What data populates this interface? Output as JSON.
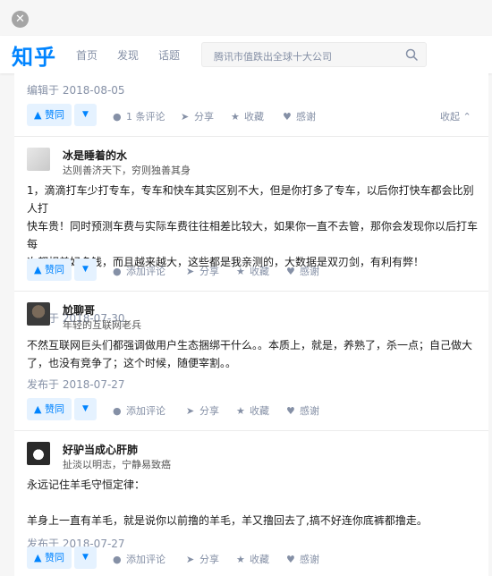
{
  "header": {
    "logo": "知乎",
    "nav": [
      "首页",
      "发现",
      "话题"
    ],
    "search_text": "腾讯市值跌出全球十大公司"
  },
  "top_answer": {
    "edit_line": "编辑于 2018-08-05",
    "actions": {
      "vote": "▲ 赞同",
      "comment": "1 条评论",
      "share": "分享",
      "favorite": "收藏",
      "thanks": "感谢",
      "collapse": "收起 ⌃"
    }
  },
  "answers": [
    {
      "author": "冰是睡着的水",
      "headline": "达则善济天下，穷则独善其身",
      "lines": [
        "1，滴滴打车少打专车，专车和快车其实区别不大，但是你打多了专车，以后你打快车都会比别人打",
        "快车贵！同时预测车费与实际车费往往相差比较大，如果你一直不去管，那你会发现你以后打车每",
        "次都相差好多钱，而且越来越大，这些都是我亲测的，大数据是双刃剑，有利有弊！"
      ],
      "published": "发布于 2018-07-30",
      "actions": {
        "vote": "▲ 赞同",
        "comment": "添加评论",
        "share": "分享",
        "favorite": "收藏",
        "thanks": "感谢"
      }
    },
    {
      "author": "尬聊哥",
      "headline": "年轻的互联网老兵",
      "lines": [
        "不然互联网巨头们都强调做用户生态捆绑干什么。。本质上，就是，养熟了，杀一点；自己做大",
        "了，也没有竞争了；这个时候，随便宰割。。"
      ],
      "published": "发布于 2018-07-27",
      "actions": {
        "vote": "▲ 赞同",
        "comment": "添加评论",
        "share": "分享",
        "favorite": "收藏",
        "thanks": "感谢"
      }
    },
    {
      "author": "好驴当成心肝肺",
      "headline": "扯淡以明志，宁静易致癌",
      "lines": [
        "永远记住羊毛守恒定律：",
        "",
        "羊身上一直有羊毛，就是说你以前撸的羊毛，羊又撸回去了,搞不好连你底裤都撸走。"
      ],
      "published": "发布于 2018-07-27",
      "actions": {
        "vote": "▲ 赞同",
        "comment": "添加评论",
        "share": "分享",
        "favorite": "收藏",
        "thanks": "感谢"
      }
    }
  ]
}
